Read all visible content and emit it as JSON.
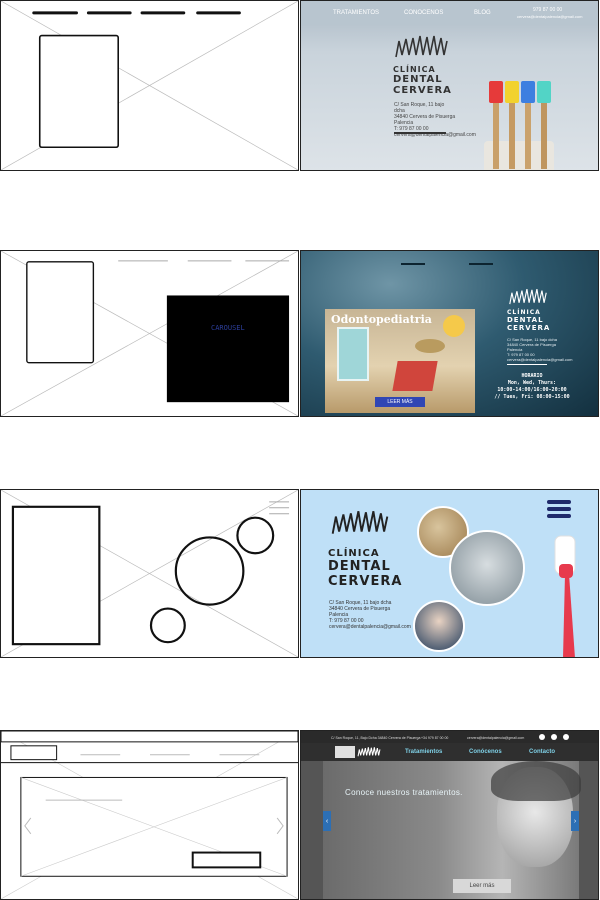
{
  "row1": {
    "nav": [
      "TRATAMIENTOS",
      "CONOCENOS",
      "BLOG"
    ],
    "phone": "979 87 00 00",
    "email": "cervera@dentalpalencia@gmail.com",
    "logo": {
      "l1": "CLÍNICA",
      "l2": "DENTAL",
      "l3": "CERVERA"
    },
    "address": [
      "C/ San Roque, 11 bajo dcha",
      "34840 Cervera de Pisuerga",
      "Palencia",
      "T: 979 87 00 00",
      "cervera@dentalpalencia@gmail.com"
    ]
  },
  "row2": {
    "carousel_label": "CAROUSEL",
    "card_title": "Odontopediatria",
    "card_button": "LEER MÁS",
    "logo": {
      "l1": "CLÍNICA",
      "l2": "DENTAL",
      "l3": "CERVERA"
    },
    "address": [
      "C/ San Roque, 11 bajo dcha",
      "34840 Cervera de Pisuerga",
      "Palencia",
      "T: 979 87 00 00",
      "cervera@dentalpalencia@gmail.com"
    ],
    "schedule_title": "HORARIO",
    "schedule_lines": [
      "Mon, Wed, Thurs:",
      "10:00-14:00/16:00-20:00",
      "// Tues, Fri: 08:00-15:00"
    ]
  },
  "row3": {
    "logo": {
      "l1": "CLÍNICA",
      "l2": "DENTAL",
      "l3": "CERVERA"
    },
    "address": [
      "C/ San Roque, 11 bajo dcha",
      "34840 Cervera de Pisuerga",
      "Palencia",
      "T: 979 87 00 00",
      "cervera@dentalpalencia@gmail.com"
    ]
  },
  "row4": {
    "topbar_address": "C/ San Roque, 11, Bajo Dcha 34840 Cervera de Pisuerga",
    "topbar_phone": "+34 979 87 00 00",
    "topbar_email": "cervera@dentalpalencia@gmail.com",
    "nav": [
      "Tratamientos",
      "Conócenos",
      "Contacto"
    ],
    "hero_text": "Conoce nuestros tratamientos.",
    "button": "Leer más",
    "social": [
      "f",
      "t",
      "i"
    ]
  },
  "colors": {
    "accent_blue": "#2c3e9a",
    "sky": "#bfe0f7",
    "ocean": "#1f4e66",
    "dark_bar": "#2a2a2a",
    "nav_teal": "#7fd0e6"
  }
}
